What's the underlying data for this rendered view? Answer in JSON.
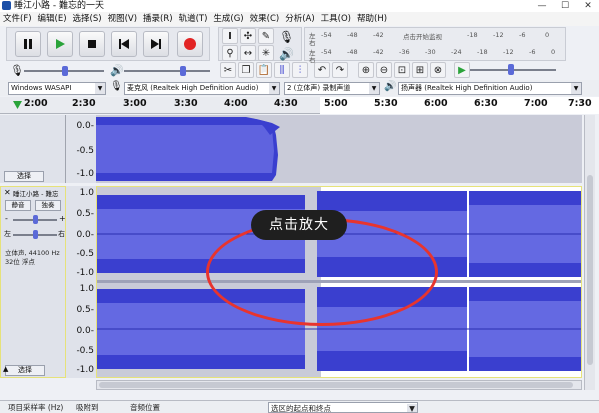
{
  "window": {
    "title": "睡江小路 - 難忘的一天",
    "controls": {
      "minimize": "—",
      "maximize": "☐",
      "close": "✕"
    }
  },
  "menu": [
    "文件(F)",
    "编辑(E)",
    "选择(S)",
    "视图(V)",
    "播录(R)",
    "轨道(T)",
    "生成(G)",
    "效果(C)",
    "分析(A)",
    "工具(O)",
    "帮助(H)"
  ],
  "meter": {
    "record_ticks": [
      "-54",
      "-48",
      "-42",
      "点击开始监视",
      "-18",
      "-12",
      "-6",
      "0"
    ],
    "play_ticks": [
      "-54",
      "-48",
      "-42",
      "-36",
      "-30",
      "-24",
      "-18",
      "-12",
      "-6",
      "0"
    ],
    "left_channel": "左",
    "right_channel": "右"
  },
  "device": {
    "host": "Windows WASAPI",
    "mic_icon_label": "麦克风 (Realtek High Definition Audio)",
    "channels": "2 (立体声) 录制声道",
    "speaker": "扬声器 (Realtek High Definition Audio)"
  },
  "ruler": [
    "2:00",
    "2:30",
    "3:00",
    "3:30",
    "4:00",
    "4:30",
    "5:00",
    "5:30",
    "6:00",
    "6:30",
    "7:00",
    "7:30"
  ],
  "track1": {
    "select_label": "选择",
    "y_labels": [
      "0.0-",
      "-0.5",
      "-1.0"
    ]
  },
  "track2": {
    "name": "睡江小路 - 難忘",
    "mute_label": "静音",
    "solo_label": "独奏",
    "gain_minus": "-",
    "gain_plus": "+",
    "pan_left": "左",
    "pan_right": "右",
    "info": "立体声, 44100 Hz\n32位 浮点",
    "select_label": "选择",
    "y_labels_top": [
      "1.0",
      "0.5-",
      "0.0-",
      "-0.5",
      "-1.0"
    ],
    "y_labels_bottom": [
      "1.0",
      "0.5-",
      "0.0-",
      "-0.5",
      "-1.0"
    ]
  },
  "callout": "点击放大",
  "status": {
    "left": "项目采样率 (Hz)",
    "snap": "吸附到",
    "audio_pos": "音频位置",
    "selection": "选区的起点和终点"
  },
  "colors": {
    "waveform": "#3a3fcf",
    "waveform_light": "#6f74e6",
    "selection_bg": "#ffffff",
    "track_bg": "#c9cbd8",
    "ring": "#e8342e"
  }
}
